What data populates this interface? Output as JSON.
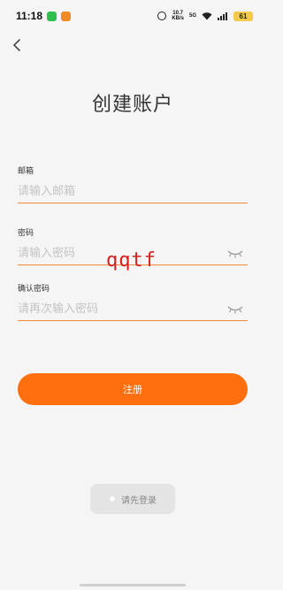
{
  "status_bar": {
    "time": "11:18",
    "speed_top": "10.7",
    "speed_unit": "KB/s",
    "network": "5G",
    "battery": "61"
  },
  "page": {
    "title": "创建账户"
  },
  "form": {
    "email": {
      "label": "邮箱",
      "placeholder": "请输入邮箱",
      "value": ""
    },
    "password": {
      "label": "密码",
      "placeholder": "请输入密码",
      "value": ""
    },
    "confirm_password": {
      "label": "确认密码",
      "placeholder": "请再次输入密码",
      "value": ""
    },
    "submit_label": "注册"
  },
  "watermark": "qqtf",
  "toast": {
    "text": "请先登录"
  },
  "colors": {
    "accent": "#ff6f0f",
    "underline": "#f08a3c",
    "watermark": "#d62020"
  }
}
